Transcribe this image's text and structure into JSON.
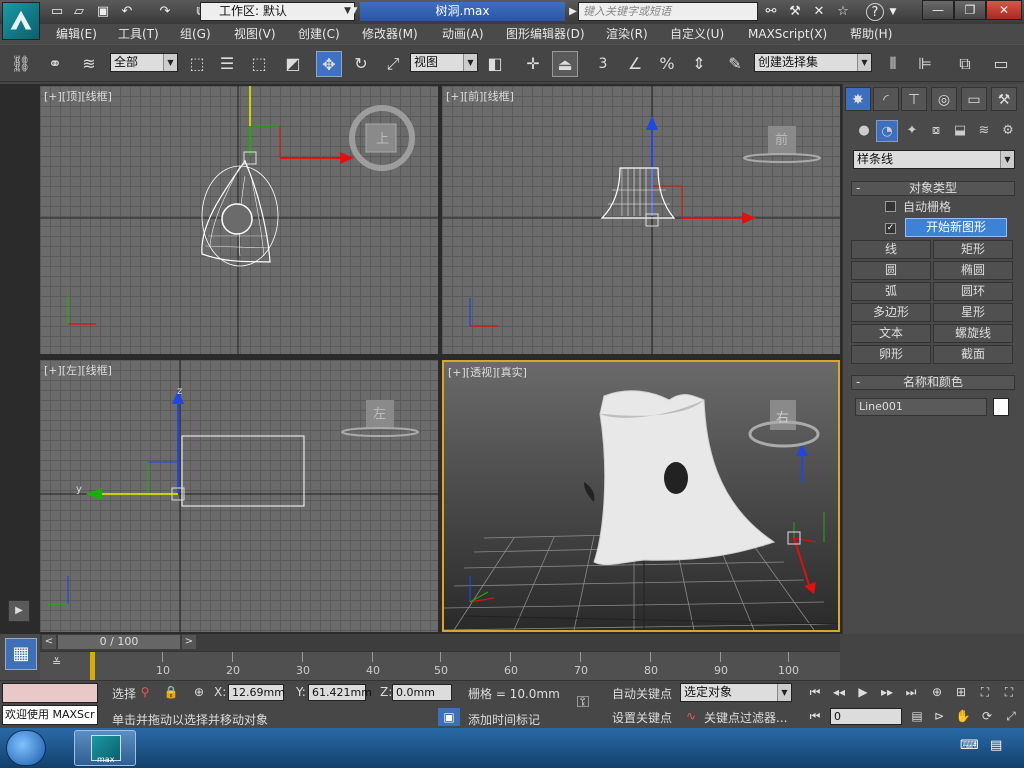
{
  "titlebar": {
    "workspace_label": "工作区: 默认",
    "filename": "树洞.max",
    "search_placeholder": "键入关键字或短语",
    "window_buttons": [
      "—",
      "❐",
      "✕"
    ]
  },
  "menu": [
    "编辑(E)",
    "工具(T)",
    "组(G)",
    "视图(V)",
    "创建(C)",
    "修改器(M)",
    "动画(A)",
    "图形编辑器(D)",
    "渲染(R)",
    "自定义(U)",
    "MAXScript(X)",
    "帮助(H)"
  ],
  "toolbar": {
    "selection_filter": "全部",
    "ref_coord": "视图",
    "snap_value": "3",
    "named_selection": "创建选择集"
  },
  "viewports": [
    {
      "label": "[+][顶][线框]",
      "viewcube": "上"
    },
    {
      "label": "[+][前][线框]",
      "viewcube": "前"
    },
    {
      "label": "[+][左][线框]",
      "viewcube": "左"
    },
    {
      "label": "[+][透视][真实]",
      "viewcube": "右"
    }
  ],
  "axis_labels": {
    "x": "x",
    "y": "y",
    "z": "z"
  },
  "cmdpanel": {
    "category": "样条线",
    "object_type_title": "对象类型",
    "autogrid": "自动栅格",
    "start_new_shape": "开始新图形",
    "shape_buttons": [
      [
        "线",
        "矩形"
      ],
      [
        "圆",
        "椭圆"
      ],
      [
        "弧",
        "圆环"
      ],
      [
        "多边形",
        "星形"
      ],
      [
        "文本",
        "螺旋线"
      ],
      [
        "卵形",
        "截面"
      ]
    ],
    "name_color_title": "名称和颜色",
    "object_name": "Line001",
    "object_color": "#ffffff"
  },
  "timeline": {
    "frame_readout": "0 / 100",
    "ticks": [
      "10",
      "20",
      "30",
      "40",
      "50",
      "60",
      "70",
      "80",
      "90",
      "100"
    ]
  },
  "status": {
    "maxscript_listener": "欢迎使用 MAXScr",
    "prompt": "单击并拖动以选择并移动对象",
    "selection_label": "选择",
    "x_label": "X:",
    "x_value": "12.69mm",
    "y_label": "Y:",
    "y_value": "61.421mm",
    "z_label": "Z:",
    "z_value": "0.0mm",
    "grid": "栅格 = 10.0mm",
    "add_time_tag": "添加时间标记",
    "auto_key": "自动关键点",
    "set_key": "设置关键点",
    "key_mode": "选定对象",
    "key_filters": "关键点过滤器...",
    "current_frame": "0"
  },
  "taskbar": {
    "app_label": "max"
  }
}
